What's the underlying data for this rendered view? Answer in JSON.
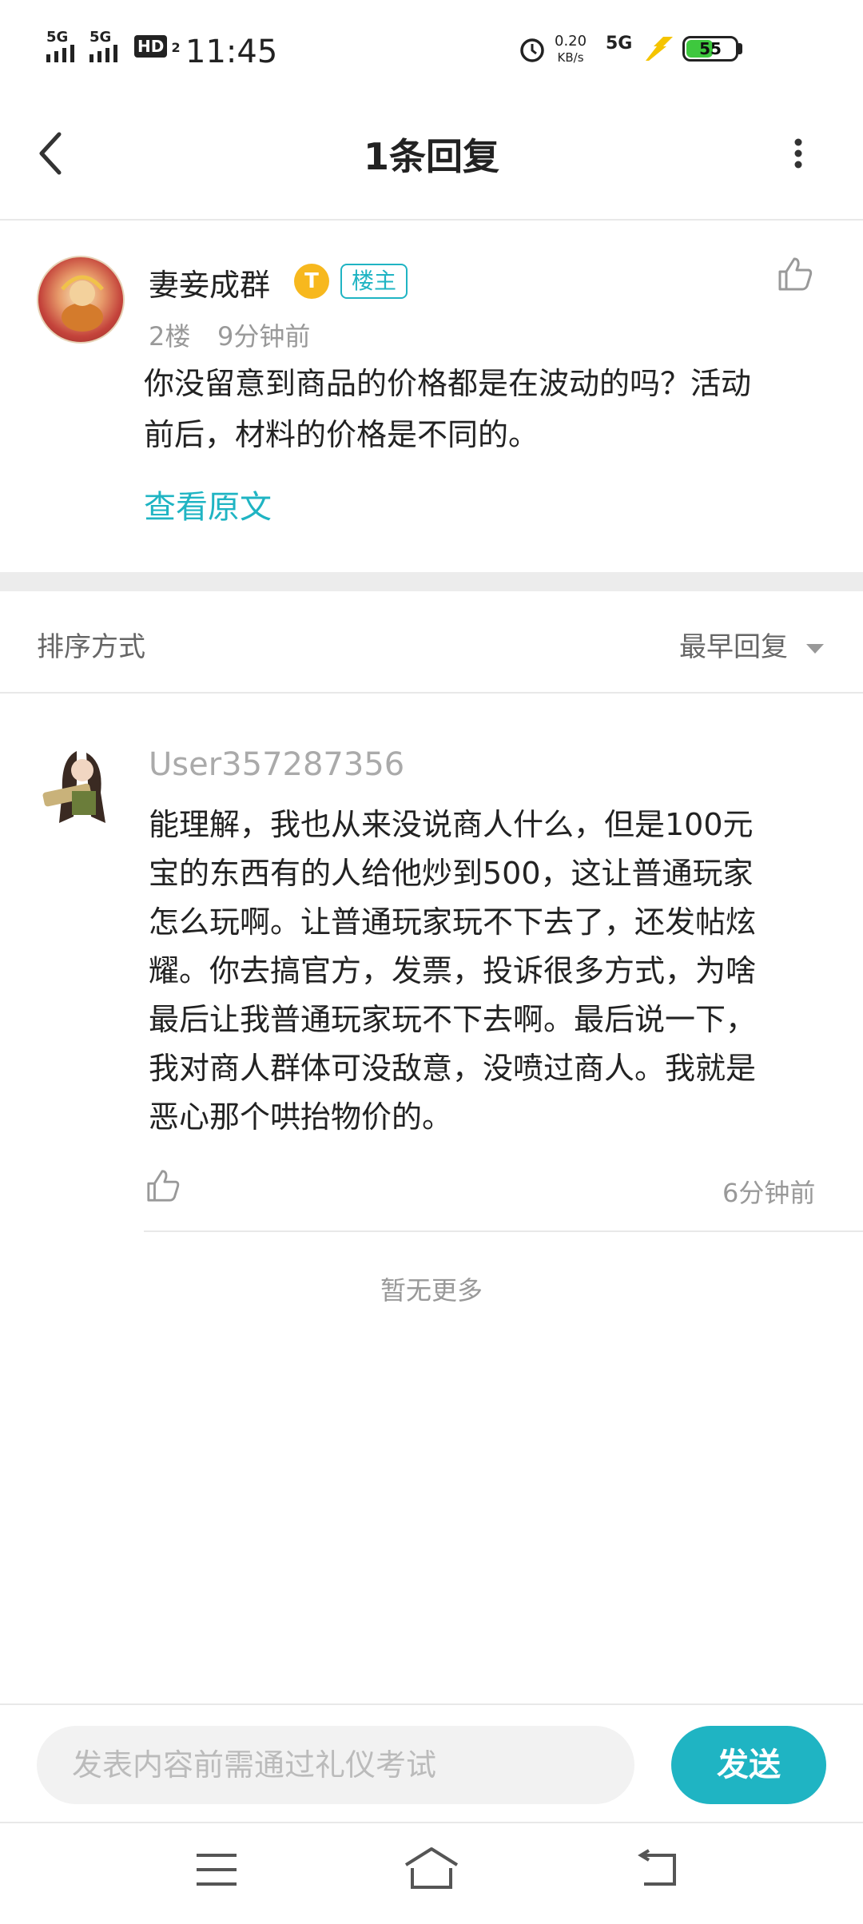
{
  "status_bar": {
    "signal1_label": "5G",
    "signal2_label": "5G",
    "hd_label": "HD",
    "hd_sub": "2",
    "time": "11:45",
    "net_speed": "0.20",
    "net_unit": "KB/s",
    "net_type": "5G",
    "battery": "55",
    "battery_level": 0.55
  },
  "header": {
    "title": "1条回复"
  },
  "post": {
    "author": "妻妾成群",
    "badge_letter": "T",
    "owner_tag": "楼主",
    "floor": "2楼",
    "time": "9分钟前",
    "text_line1": "你没留意到商品的价格都是在波动的吗？活动",
    "text_line2": "前后，材料的价格是不同的。",
    "view_original": "查看原文"
  },
  "sort": {
    "label": "排序方式",
    "value": "最早回复"
  },
  "reply": {
    "author": "User357287356",
    "lines": [
      "能理解，我也从来没说商人什么，但是100元",
      "宝的东西有的人给他炒到500，这让普通玩家",
      "怎么玩啊。让普通玩家玩不下去了，还发帖炫",
      "耀。你去搞官方，发票，投诉很多方式，为啥",
      "最后让我普通玩家玩不下去啊。最后说一下，",
      "我对商人群体可没敌意，没喷过商人。我就是",
      "恶心那个哄抬物价的。"
    ],
    "time": "6分钟前"
  },
  "no_more": "暂无更多",
  "composer": {
    "placeholder": "发表内容前需通过礼仪考试",
    "send_label": "发送"
  },
  "colors": {
    "accent": "#1fb4c3",
    "battery": "#3ec83e"
  },
  "icons": [
    "back-icon",
    "more-icon",
    "like-icon",
    "menu-icon",
    "home-icon",
    "return-icon",
    "alarm-icon",
    "charging-icon",
    "caret-down-icon"
  ]
}
